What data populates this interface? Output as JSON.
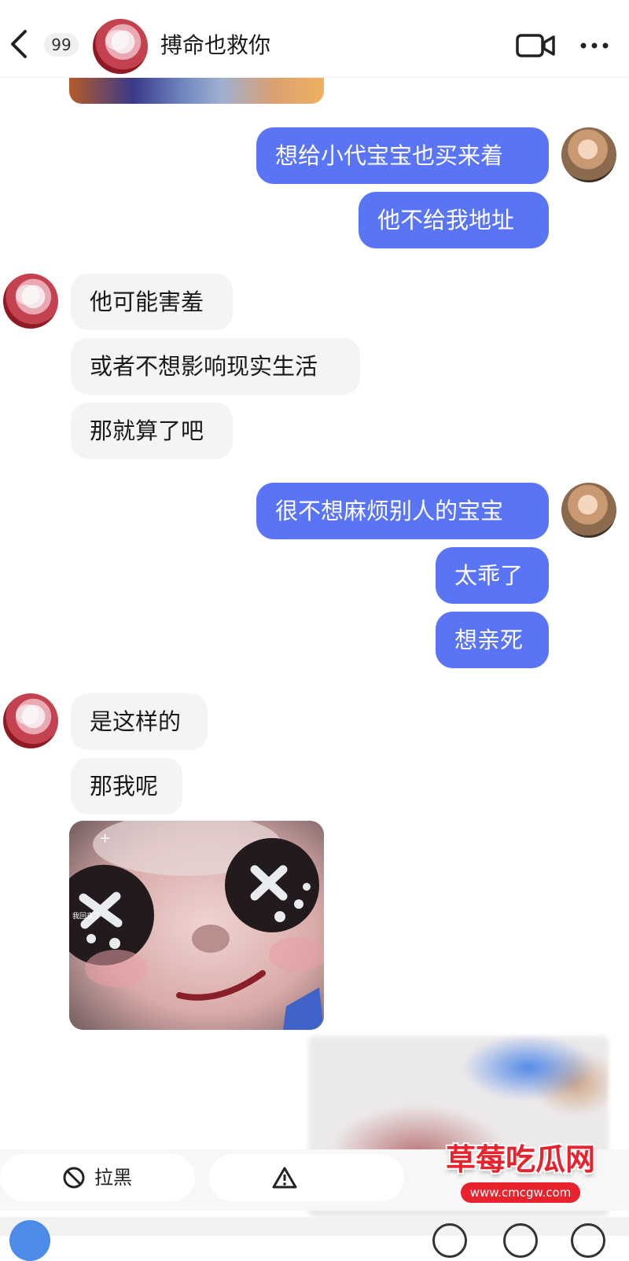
{
  "header": {
    "badge_count": "99",
    "title": "搏命也救你"
  },
  "messages": [
    {
      "side": "out",
      "text": "想给小代宝宝也买来着"
    },
    {
      "side": "out",
      "text": "他不给我地址"
    },
    {
      "side": "in",
      "text": "他可能害羞"
    },
    {
      "side": "in",
      "text": "或者不想影响现实生活"
    },
    {
      "side": "in",
      "text": "那就算了吧"
    },
    {
      "side": "out",
      "text": "很不想麻烦别人的宝宝"
    },
    {
      "side": "out",
      "text": "太乖了"
    },
    {
      "side": "out",
      "text": "想亲死"
    },
    {
      "side": "in",
      "text": "是这样的"
    },
    {
      "side": "in",
      "text": "那我呢"
    }
  ],
  "sticker_caption": "我回来了",
  "actions": {
    "block_label": "拉黑"
  },
  "watermark": {
    "title": "草莓吃瓜网",
    "url": "www.cmcgw.com"
  },
  "colors": {
    "outgoing_bubble": "#5a74f6",
    "incoming_bubble": "#f4f4f6",
    "watermark_red": "#e8232e"
  },
  "icons": [
    "chevron-left-icon",
    "video-camera-icon",
    "more-dots-icon",
    "block-icon",
    "warning-icon"
  ]
}
